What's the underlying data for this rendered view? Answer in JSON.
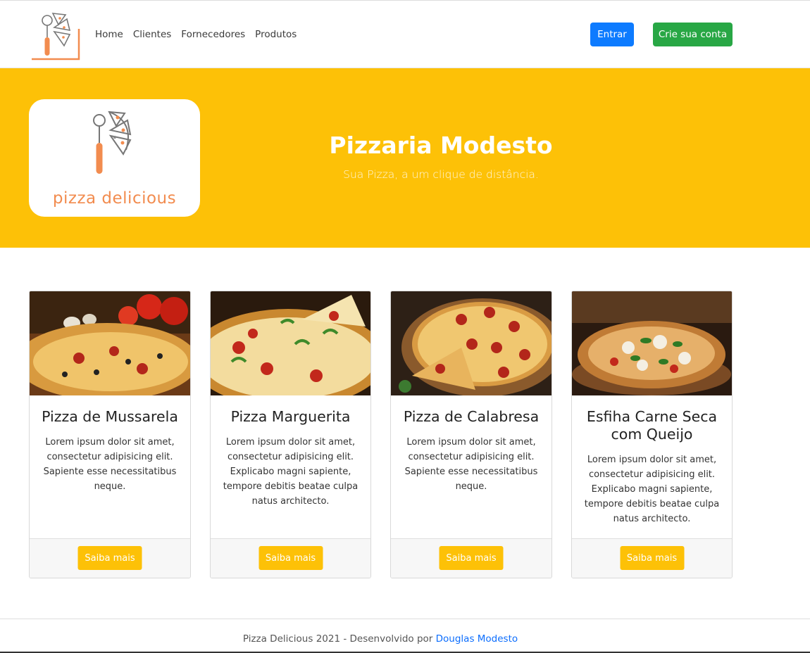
{
  "nav": {
    "links": [
      "Home",
      "Clientes",
      "Fornecedores",
      "Produtos"
    ],
    "login_label": "Entrar",
    "signup_label": "Crie sua conta"
  },
  "hero": {
    "logo_text": "pizza delicious",
    "title": "Pizzaria Modesto",
    "subtitle": "Sua Pizza, a um clique de distância."
  },
  "cards": [
    {
      "title": "Pizza de Mussarela",
      "text": "Lorem ipsum dolor sit amet, consectetur adipisicing elit. Sapiente esse necessitatibus neque.",
      "button": "Saiba mais"
    },
    {
      "title": "Pizza Marguerita",
      "text": "Lorem ipsum dolor sit amet, consectetur adipisicing elit. Explicabo magni sapiente, tempore debitis beatae culpa natus architecto.",
      "button": "Saiba mais"
    },
    {
      "title": "Pizza de Calabresa",
      "text": "Lorem ipsum dolor sit amet, consectetur adipisicing elit. Sapiente esse necessitatibus neque.",
      "button": "Saiba mais"
    },
    {
      "title": "Esfiha Carne Seca com Queijo",
      "text": "Lorem ipsum dolor sit amet, consectetur adipisicing elit. Explicabo magni sapiente, tempore debitis beatae culpa natus architecto.",
      "button": "Saiba mais"
    }
  ],
  "footer": {
    "text": "Pizza Delicious 2021 - Desenvolvido por",
    "author_link": "Douglas Modesto"
  },
  "colors": {
    "accent_yellow": "#fdc107",
    "primary_blue": "#0d7bff",
    "success_green": "#28a745",
    "logo_orange": "#f28c4f"
  },
  "icons": [
    "pizza-cutter-logo-icon"
  ]
}
